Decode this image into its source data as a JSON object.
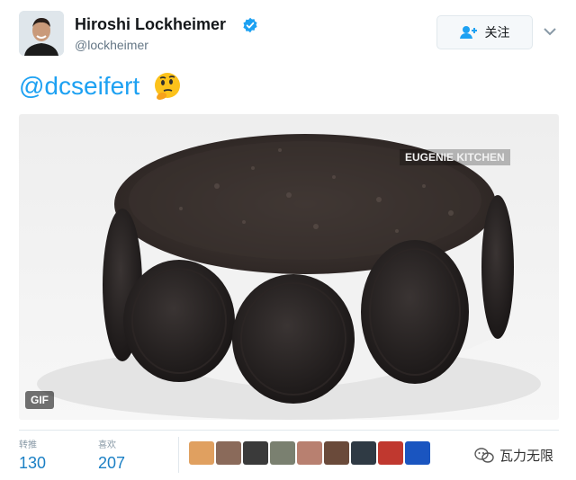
{
  "user": {
    "display_name": "Hiroshi Lockheimer",
    "handle": "@lockheimer"
  },
  "actions": {
    "follow_label": "关注"
  },
  "tweet": {
    "text": "@dcseifert",
    "emoji": "thinking-face-emoji"
  },
  "media": {
    "badge": "GIF",
    "watermark": "EUGENIE KITCHEN"
  },
  "stats": {
    "retweets": {
      "label": "转推",
      "count": "130"
    },
    "likes": {
      "label": "喜欢",
      "count": "207"
    }
  },
  "likers": [
    "#e0a060",
    "#8a6a5a",
    "#3a3a3a",
    "#7a8070",
    "#b88070",
    "#6a4a3a",
    "#2f3a44",
    "#c0382f",
    "#1a55c0"
  ],
  "footer": {
    "brand": "瓦力无限"
  },
  "colors": {
    "link": "#1da1f2",
    "verified": "#1da1f2",
    "count": "#1a7fc4"
  }
}
